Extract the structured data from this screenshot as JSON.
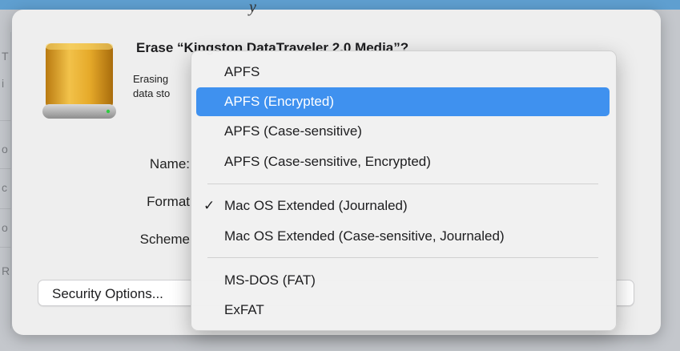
{
  "background": {
    "fragments": [
      "T",
      "i",
      "o",
      "c",
      "o",
      "R"
    ]
  },
  "dialog": {
    "top_fragment": "y",
    "title": "Erase “Kingston DataTraveler 2.0 Media”?",
    "description": "Erasing\ndata sto",
    "labels": {
      "name": "Name:",
      "format": "Format",
      "scheme": "Scheme"
    },
    "security_button": "Security Options..."
  },
  "format_menu": {
    "items": [
      {
        "label": "APFS",
        "checked": false,
        "highlighted": false
      },
      {
        "label": "APFS (Encrypted)",
        "checked": false,
        "highlighted": true
      },
      {
        "label": "APFS (Case-sensitive)",
        "checked": false,
        "highlighted": false
      },
      {
        "label": "APFS (Case-sensitive, Encrypted)",
        "checked": false,
        "highlighted": false
      },
      {
        "label": "Mac OS Extended (Journaled)",
        "checked": true,
        "highlighted": false
      },
      {
        "label": "Mac OS Extended (Case-sensitive, Journaled)",
        "checked": false,
        "highlighted": false
      },
      {
        "label": "MS-DOS (FAT)",
        "checked": false,
        "highlighted": false
      },
      {
        "label": "ExFAT",
        "checked": false,
        "highlighted": false
      }
    ],
    "check_glyph": "✓"
  },
  "colors": {
    "highlight": "#3f91ef",
    "disk_body": "#e3a623",
    "disk_base": "#b9b9b9"
  },
  "icons": {
    "disk": "external-drive-icon"
  }
}
